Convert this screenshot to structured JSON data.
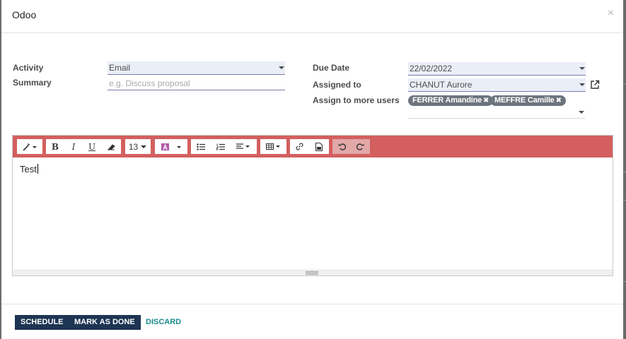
{
  "dialog": {
    "title": "Odoo",
    "close_glyph": "×"
  },
  "form": {
    "activity": {
      "label": "Activity",
      "value": "Email"
    },
    "summary": {
      "label": "Summary",
      "placeholder": "e.g. Discuss proposal"
    },
    "due_date": {
      "label": "Due Date",
      "value": "22/02/2022"
    },
    "assigned_to": {
      "label": "Assigned to",
      "value": "CHANUT Aurore"
    },
    "assign_more": {
      "label": "Assign to more users",
      "tags": [
        {
          "name": "FERRER Amandine",
          "remove": "✖"
        },
        {
          "name": "MEFFRE Camille",
          "remove": "✖"
        }
      ]
    }
  },
  "editor": {
    "toolbar_color": "#d35f5f",
    "font_size": "13",
    "buttons": [
      "magic-wand-icon",
      "bold-icon",
      "italic-icon",
      "underline-icon",
      "eraser-icon",
      "font-color-icon",
      "bullet-list-icon",
      "numbered-list-icon",
      "align-icon",
      "table-icon",
      "link-icon",
      "image-icon",
      "undo-icon",
      "redo-icon"
    ],
    "body_text": "Test"
  },
  "footer": {
    "schedule": "SCHEDULE",
    "mark_done": "MARK AS DONE",
    "discard": "DISCARD"
  },
  "colors": {
    "primary": "#1d3452",
    "link": "#1b8b8e",
    "field_underline": "#7c7bad",
    "tag": "#6c757d"
  }
}
